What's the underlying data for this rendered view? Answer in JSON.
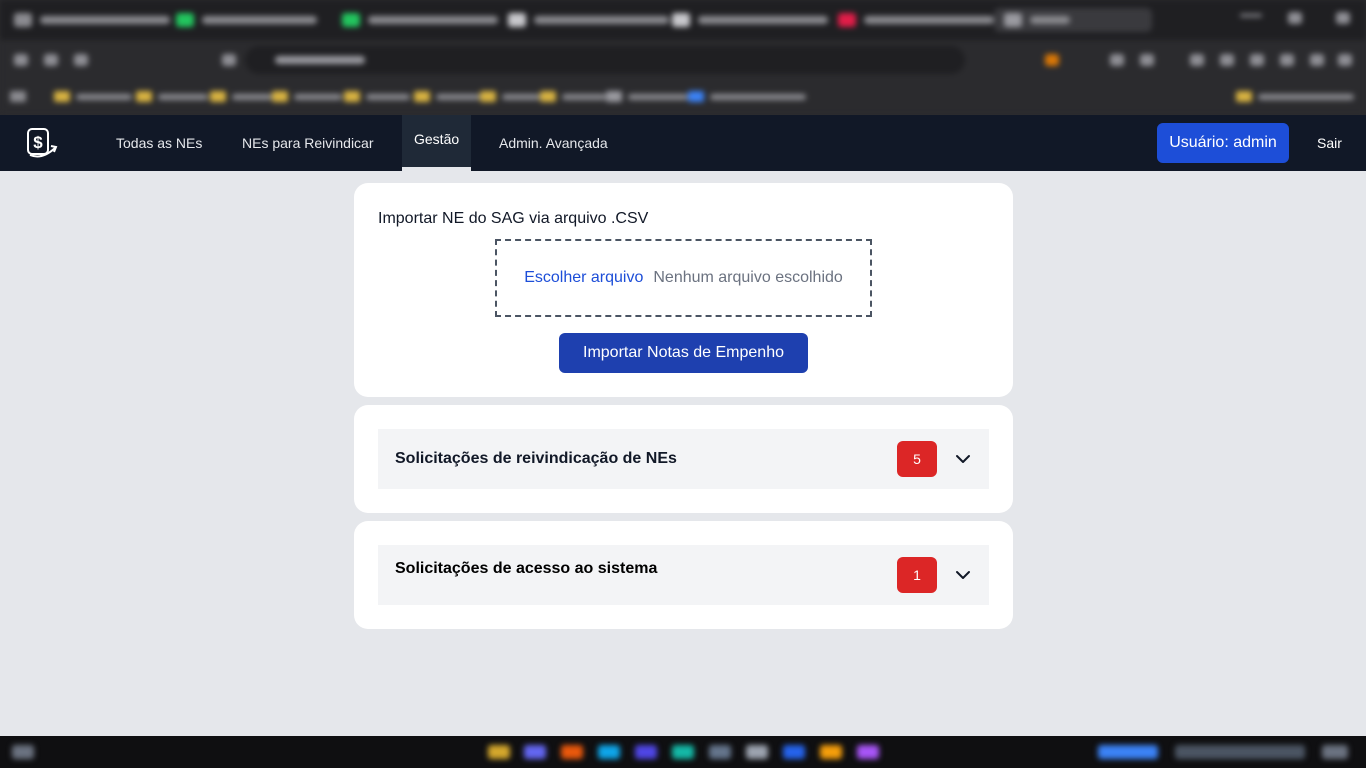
{
  "nav": {
    "items": [
      {
        "label": "Todas as NEs"
      },
      {
        "label": "NEs para Reivindicar"
      },
      {
        "label": "Gestão"
      },
      {
        "label": "Admin. Avançada"
      }
    ],
    "user_label": "Usuário: admin",
    "logout_label": "Sair"
  },
  "import": {
    "title": "Importar NE do SAG via arquivo .CSV",
    "choose_label": "Escolher arquivo",
    "no_file_label": "Nenhum arquivo escolhido",
    "button_label": "Importar Notas de Empenho"
  },
  "accordions": [
    {
      "title": "Solicitações de reivindicação de NEs",
      "count": "5"
    },
    {
      "title": "Solicitações de acesso ao sistema",
      "count": "1"
    }
  ],
  "colors": {
    "nav_bg": "#111827",
    "primary": "#1d4ed8",
    "badge": "#dc2626",
    "page_bg": "#e5e7eb"
  }
}
